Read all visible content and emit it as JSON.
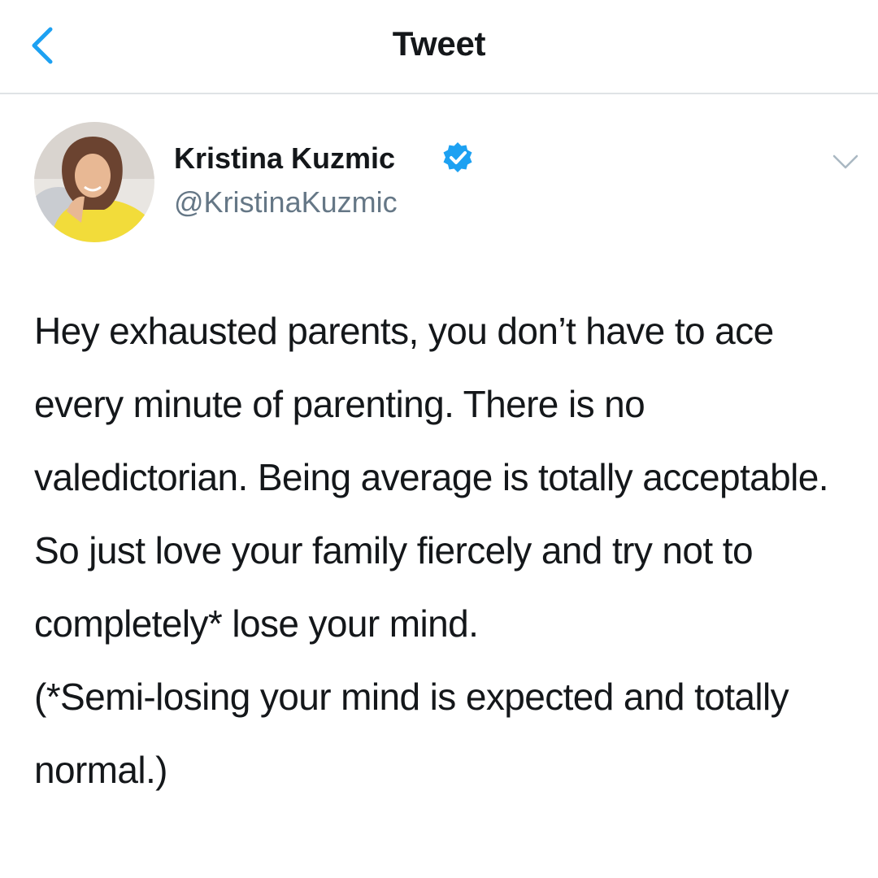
{
  "header": {
    "title": "Tweet",
    "back_icon": "chevron-left-icon"
  },
  "tweet": {
    "author_name": "Kristina Kuzmic",
    "author_handle": "@KristinaKuzmic",
    "verified": true,
    "verified_icon": "verified-badge-icon",
    "more_icon": "chevron-down-icon",
    "text": "Hey exhausted parents, you don’t have to ace every minute of parenting. There is no valedictorian. Being average is totally acceptable. So just love your family fiercely and try not to completely* lose your mind.\n(*Semi-losing your mind is expected and totally normal.)"
  },
  "colors": {
    "accent": "#1da1f2",
    "text": "#14171a",
    "secondary": "#657786",
    "divider": "#dfe3e6"
  }
}
